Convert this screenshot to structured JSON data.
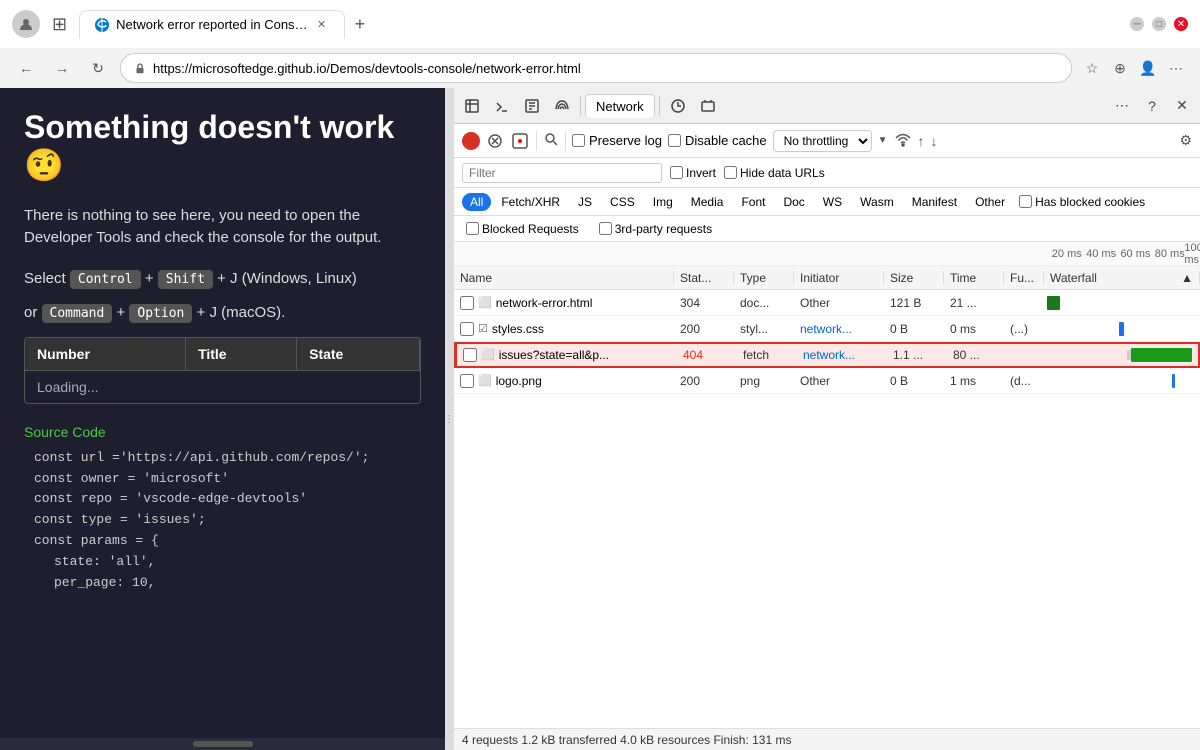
{
  "browser": {
    "url": "https://microsoftedge.github.io/Demos/devtools-console/network-error.html",
    "tab_title": "Network error reported in Cons…",
    "new_tab_tooltip": "New tab"
  },
  "webpage": {
    "heading": "Something doesn't work 🤨",
    "body_text": "There is nothing to see here, you need to open the Developer Tools and check the console for the output.",
    "instruction_select": "Select",
    "instruction_or": "or",
    "kbd_control": "Control",
    "kbd_shift": "Shift",
    "kbd_j": "+ J",
    "instruction_windows": "(Windows, Linux)",
    "kbd_command": "Command",
    "kbd_option": "Option",
    "instruction_macos": "(macOS).",
    "table_headers": [
      "Number",
      "Title",
      "State"
    ],
    "table_loading": "Loading...",
    "source_label": "Source Code",
    "code_lines": [
      "const url ='https://api.github.com/repos/';",
      "const owner = 'microsoft'",
      "const repo = 'vscode-edge-devtools'",
      "const type = 'issues';",
      "const params = {",
      "    state: 'all',",
      "    per_page: 10,"
    ]
  },
  "devtools": {
    "tab_network": "Network",
    "toolbar_icons": [
      "inspector",
      "console",
      "sources",
      "network",
      "performance",
      "memory",
      "application",
      "security"
    ],
    "more_tools": "More tools",
    "help": "Help",
    "close": "Close",
    "record_tooltip": "Record",
    "clear_tooltip": "Clear",
    "preserve_log_label": "Preserve log",
    "disable_cache_label": "Disable cache",
    "throttle_value": "No throttling",
    "invert_label": "Invert",
    "hide_data_urls_label": "Hide data URLs",
    "filter_placeholder": "Filter",
    "type_filters": [
      "All",
      "Fetch/XHR",
      "JS",
      "CSS",
      "Img",
      "Media",
      "Font",
      "Doc",
      "WS",
      "Wasm",
      "Manifest",
      "Other"
    ],
    "blocked_requests_label": "Blocked Requests",
    "third_party_label": "3rd-party requests",
    "has_blocked_cookies_label": "Has blocked cookies",
    "table_headers": {
      "name": "Name",
      "status": "Stat...",
      "type": "Type",
      "initiator": "Initiator",
      "size": "Size",
      "time": "Time",
      "fu": "Fu...",
      "waterfall": "Waterfall"
    },
    "timeline_marks": [
      "20 ms",
      "40 ms",
      "60 ms",
      "80 ms",
      "100 ms"
    ],
    "network_rows": [
      {
        "name": "network-error.html",
        "status": "304",
        "type": "doc...",
        "initiator": "Other",
        "size": "121 B",
        "time": "21 ...",
        "fu": "",
        "initiator_type": "other",
        "waterfall_type": "green",
        "waterfall_left": "2%",
        "waterfall_width": "8%",
        "error": false
      },
      {
        "name": "styles.css",
        "status": "200",
        "type": "styl...",
        "initiator": "network...",
        "size": "0 B",
        "time": "0 ms",
        "fu": "(...",
        "initiator_type": "link",
        "waterfall_type": "blue",
        "waterfall_left": "48%",
        "waterfall_width": "3%",
        "error": false
      },
      {
        "name": "issues?state=all&p...",
        "status": "404",
        "type": "fetch",
        "initiator": "network...",
        "size": "1.1 ...",
        "time": "80 ...",
        "fu": "",
        "initiator_type": "link",
        "waterfall_type": "green-wide",
        "waterfall_left": "55%",
        "waterfall_width": "40%",
        "error": true
      },
      {
        "name": "logo.png",
        "status": "200",
        "type": "png",
        "initiator": "Other",
        "size": "0 B",
        "time": "1 ms",
        "fu": "(d...",
        "initiator_type": "other",
        "waterfall_type": "blue-thin",
        "waterfall_left": "82%",
        "waterfall_width": "2%",
        "error": false
      }
    ],
    "status_bar": "4 requests  1.2 kB transferred  4.0 kB resources  Finish: 131 ms"
  }
}
